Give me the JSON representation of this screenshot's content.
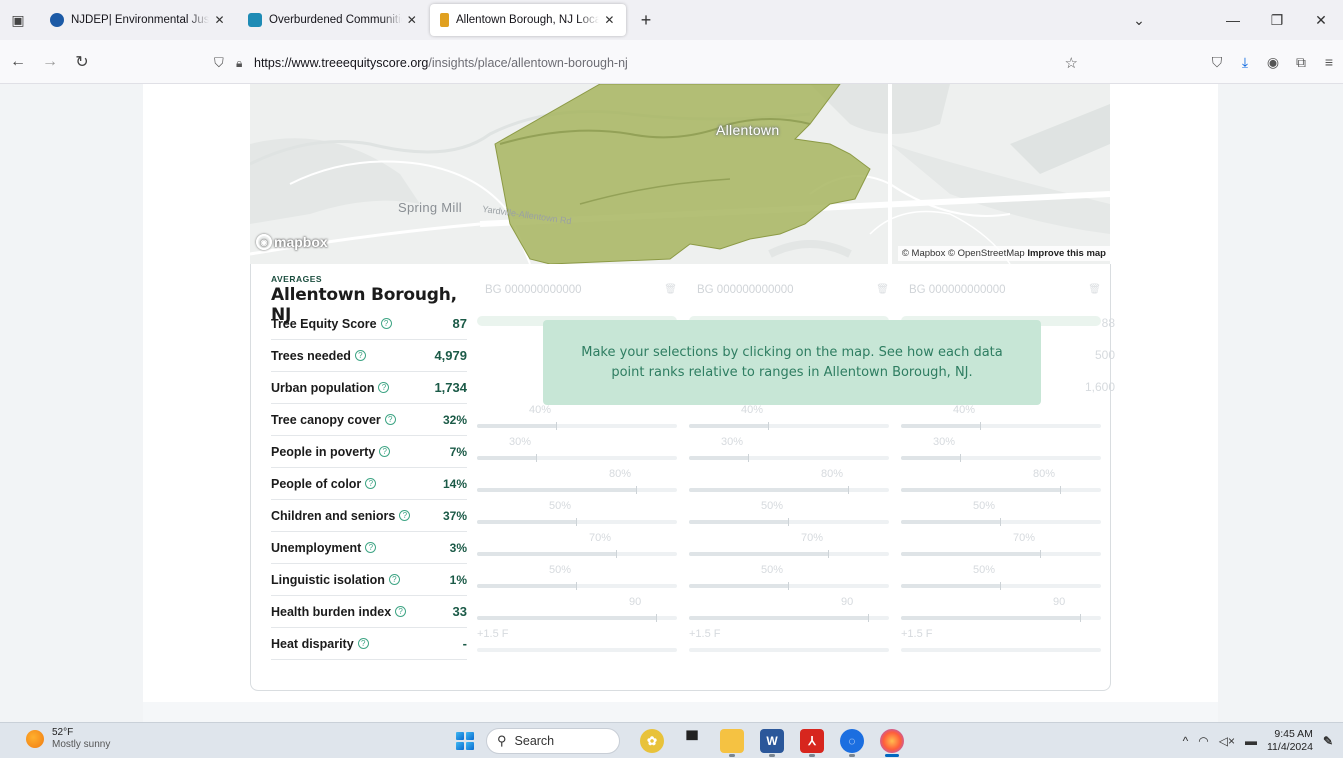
{
  "browser": {
    "tabs": [
      {
        "title": "NJDEP| Environmental Justice | NJ",
        "active": false,
        "favicon_color": "#1c5aa6"
      },
      {
        "title": "Overburdened Communities | NJ",
        "active": false,
        "favicon_color": "#1e8bb5"
      },
      {
        "title": "Allentown Borough, NJ Location",
        "active": true,
        "favicon_color": "#e0a020"
      }
    ],
    "url_host": "https://www.treeequityscore.org",
    "url_path": "/insights/place/allentown-borough-nj"
  },
  "map": {
    "labels": {
      "town": "Allentown",
      "spring_mill": "Spring Mill",
      "road": "Yardville-Allentown Rd"
    },
    "logo": "mapbox",
    "attribution": "© Mapbox © OpenStreetMap",
    "improve": "Improve this map",
    "polygon_color": "#a7b55f"
  },
  "panel": {
    "averages_tag": "AVERAGES",
    "place": "Allentown Borough, NJ",
    "overlay_text": "Make your selections by clicking on the map. See how each data point ranks relative to ranges in Allentown Borough, NJ.",
    "metrics": [
      {
        "label": "Tree Equity Score",
        "value": "87"
      },
      {
        "label": "Trees needed",
        "value": "4,979"
      },
      {
        "label": "Urban population",
        "value": "1,734"
      },
      {
        "label": "Tree canopy cover",
        "value": "32%"
      },
      {
        "label": "People in poverty",
        "value": "7%"
      },
      {
        "label": "People of color",
        "value": "14%"
      },
      {
        "label": "Children and seniors",
        "value": "37%"
      },
      {
        "label": "Unemployment",
        "value": "3%"
      },
      {
        "label": "Linguistic isolation",
        "value": "1%"
      },
      {
        "label": "Health burden index",
        "value": "33"
      },
      {
        "label": "Heat disparity",
        "value": "-"
      }
    ],
    "block_groups": [
      {
        "name": "BG 000000000000"
      },
      {
        "name": "BG 000000000000"
      },
      {
        "name": "BG 000000000000"
      }
    ],
    "bg_right_values": {
      "score": "88",
      "trees": "500",
      "pop": "1,600"
    },
    "bars": [
      {
        "label": "40%",
        "fill": 0.4
      },
      {
        "label": "30%",
        "fill": 0.3
      },
      {
        "label": "80%",
        "fill": 0.8
      },
      {
        "label": "50%",
        "fill": 0.5
      },
      {
        "label": "70%",
        "fill": 0.7
      },
      {
        "label": "50%",
        "fill": 0.5
      },
      {
        "label": "90",
        "fill": 0.9
      },
      {
        "label": "+1.5 F",
        "fill": 0.0
      }
    ]
  },
  "taskbar": {
    "temp": "52°F",
    "weather": "Mostly sunny",
    "search": "Search",
    "time": "9:45 AM",
    "date": "11/4/2024"
  }
}
